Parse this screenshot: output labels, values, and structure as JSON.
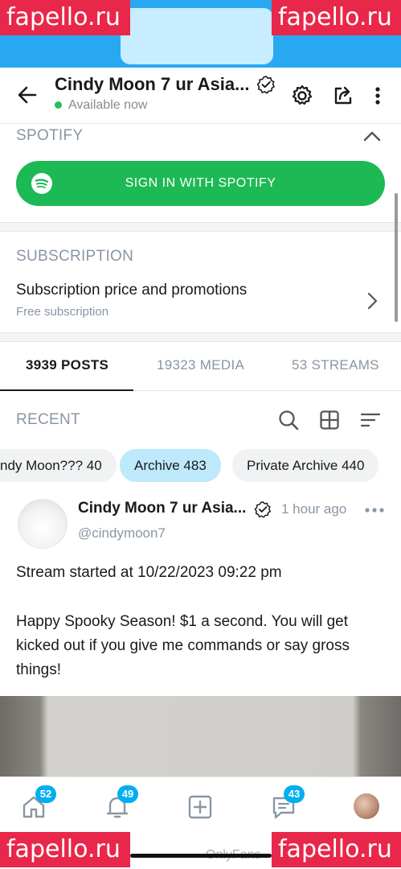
{
  "watermarks": {
    "top_left": "fapello.ru",
    "top_right": "fapello.ru",
    "bottom_left": "fapello.ru",
    "bottom_right": "fapello.ru"
  },
  "header": {
    "title": "Cindy Moon 7 ur Asia...",
    "status": "Available now"
  },
  "spotify": {
    "section_label": "SPOTIFY",
    "button_label": "SIGN IN WITH SPOTIFY"
  },
  "subscription": {
    "section_label": "SUBSCRIPTION",
    "row_title": "Subscription price and promotions",
    "row_subtitle": "Free subscription"
  },
  "tabs": [
    {
      "label": "3939 POSTS",
      "active": true
    },
    {
      "label": "19323 MEDIA",
      "active": false
    },
    {
      "label": "53 STREAMS",
      "active": false
    }
  ],
  "recent": {
    "label": "RECENT"
  },
  "chips": [
    {
      "label": "ndy Moon??? 40",
      "active": false
    },
    {
      "label": "Archive 483",
      "active": true
    },
    {
      "label": "Private Archive 440",
      "active": false
    }
  ],
  "post": {
    "author": "Cindy Moon 7 ur Asia...",
    "time": "1 hour ago",
    "handle": "@cindymoon7",
    "line1": "Stream started at 10/22/2023 09:22 pm",
    "line2": "Happy Spooky Season! $1 a second. You will get kicked out if you give me commands or say gross things!"
  },
  "nav": {
    "home_badge": "52",
    "notifications_badge": "49",
    "messages_badge": "43"
  },
  "footer": {
    "partial_text": "OnlyFans"
  },
  "colors": {
    "accent": "#00aff0",
    "spotify": "#1db954",
    "online": "#27c05c",
    "watermark": "#e8274b"
  }
}
